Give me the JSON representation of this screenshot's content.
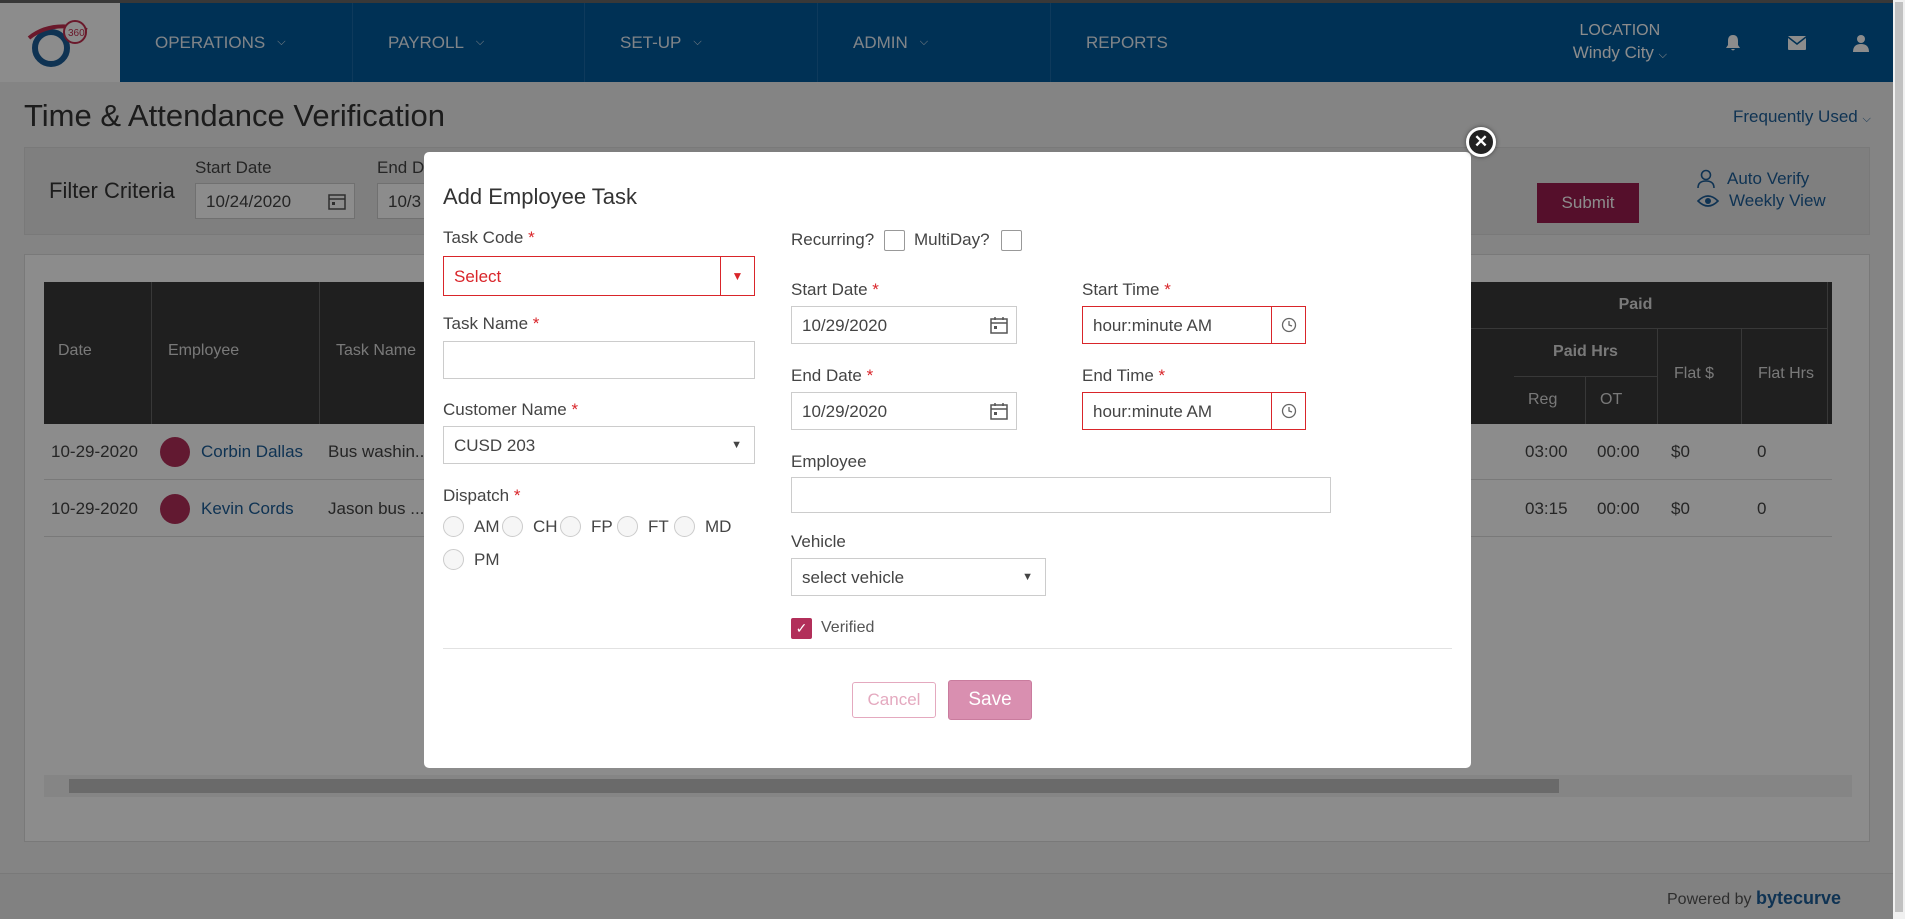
{
  "nav": {
    "menu": [
      {
        "label": "OPERATIONS"
      },
      {
        "label": "PAYROLL"
      },
      {
        "label": "SET-UP"
      },
      {
        "label": "ADMIN"
      },
      {
        "label": "REPORTS"
      }
    ],
    "location_label": "LOCATION",
    "location_value": "Windy City",
    "icons": [
      "bell-icon",
      "envelope-icon",
      "user-icon"
    ]
  },
  "page": {
    "title": "Time & Attendance Verification",
    "frequently_used": "Frequently Used"
  },
  "filter": {
    "title": "Filter Criteria",
    "start_date_label": "Start Date",
    "start_date_value": "10/24/2020",
    "end_date_label": "End Da",
    "end_date_value": "10/3",
    "submit_label": "Submit",
    "auto_verify": "Auto Verify",
    "weekly_view": "Weekly View"
  },
  "grid": {
    "headers": {
      "date": "Date",
      "employee": "Employee",
      "task_name": "Task Name",
      "paid": "Paid",
      "paid_hrs": "Paid Hrs",
      "reg": "Reg",
      "ot": "OT",
      "flat_dollar": "Flat $",
      "flat_hrs": "Flat Hrs"
    },
    "rows": [
      {
        "date": "10-29-2020",
        "employee": "Corbin Dallas",
        "task": "Bus washin...",
        "reg": "03:00",
        "ot": "00:00",
        "flat_dollar": "$0",
        "flat_hrs": "0"
      },
      {
        "date": "10-29-2020",
        "employee": "Kevin Cords",
        "task": "Jason bus ...",
        "reg": "03:15",
        "ot": "00:00",
        "flat_dollar": "$0",
        "flat_hrs": "0"
      }
    ]
  },
  "modal": {
    "title": "Add Employee Task",
    "task_code_label": "Task Code",
    "task_code_value": "Select",
    "task_name_label": "Task Name",
    "task_name_value": "",
    "customer_name_label": "Customer Name",
    "customer_name_value": "CUSD 203",
    "dispatch_label": "Dispatch",
    "dispatch_options": [
      "AM",
      "CH",
      "FP",
      "FT",
      "MD",
      "PM"
    ],
    "recurring_label": "Recurring?",
    "multiday_label": "MultiDay?",
    "start_date_label": "Start Date",
    "start_date_value": "10/29/2020",
    "end_date_label": "End Date",
    "end_date_value": "10/29/2020",
    "start_time_label": "Start Time",
    "start_time_placeholder": "hour:minute AM",
    "end_time_label": "End Time",
    "end_time_placeholder": "hour:minute AM",
    "employee_label": "Employee",
    "employee_value": "",
    "vehicle_label": "Vehicle",
    "vehicle_value": "select vehicle",
    "verified_label": "Verified",
    "verified_checked": true,
    "cancel_label": "Cancel",
    "save_label": "Save",
    "required_mark": "*"
  },
  "footer": {
    "powered_by": "Powered by",
    "brand": "bytecurve"
  },
  "colors": {
    "nav_blue": "#005a9c",
    "accent_magenta": "#9c1d4f",
    "error_red": "#d9252a",
    "link_blue": "#1d5d97"
  }
}
